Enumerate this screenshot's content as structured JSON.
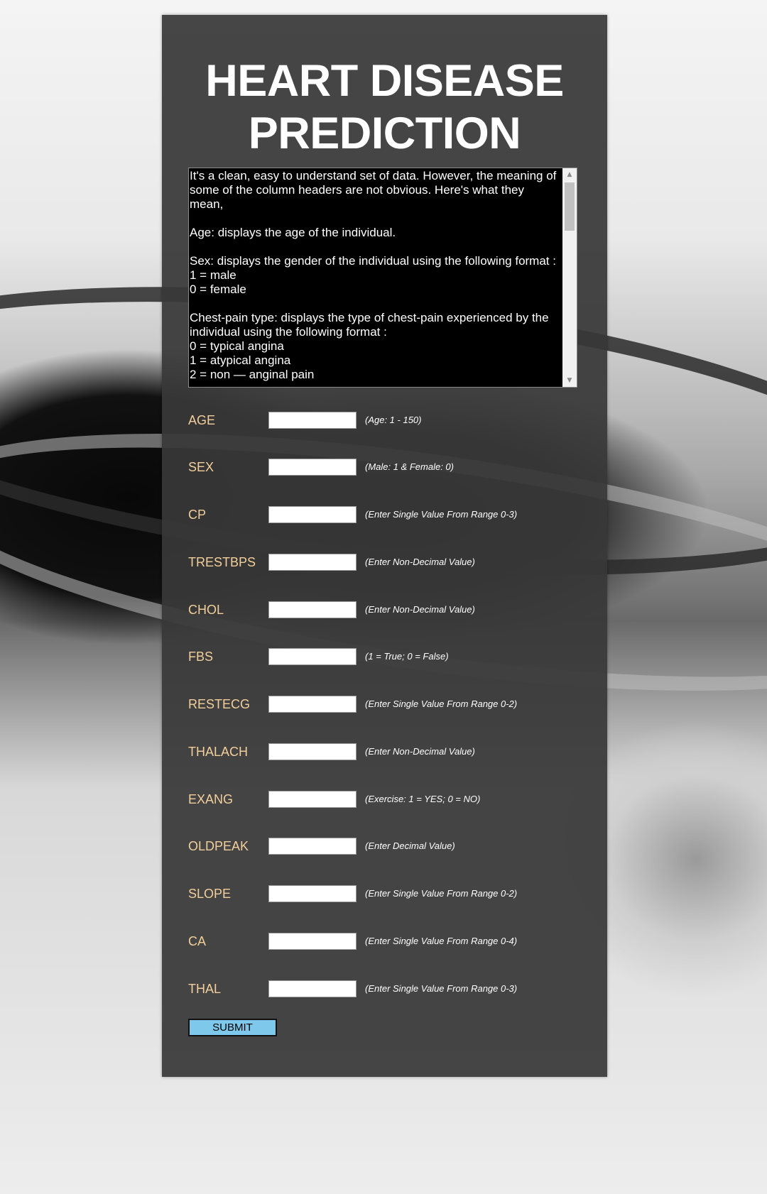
{
  "page": {
    "title": "HEART DISEASE PREDICTION"
  },
  "description": {
    "text": "It's a clean, easy to understand set of data. However, the meaning of some of the column headers are not obvious. Here's what they mean,\n\nAge: displays the age of the individual.\n\nSex: displays the gender of the individual using the following format :\n1 = male\n0 = female\n\nChest-pain type: displays the type of chest-pain experienced by the individual using the following format :\n0 = typical angina\n1 = atypical angina\n2 = non — anginal pain"
  },
  "form": {
    "fields": [
      {
        "label": "AGE",
        "value": "",
        "hint": "(Age: 1 - 150)"
      },
      {
        "label": "SEX",
        "value": "",
        "hint": "(Male: 1 & Female: 0)"
      },
      {
        "label": "CP",
        "value": "",
        "hint": "(Enter Single Value From Range 0-3)"
      },
      {
        "label": "TRESTBPS",
        "value": "",
        "hint": "(Enter Non-Decimal Value)"
      },
      {
        "label": "CHOL",
        "value": "",
        "hint": "(Enter Non-Decimal Value)"
      },
      {
        "label": "FBS",
        "value": "",
        "hint": "(1 = True; 0 = False)"
      },
      {
        "label": "RESTECG",
        "value": "",
        "hint": "(Enter Single Value From Range 0-2)"
      },
      {
        "label": "THALACH",
        "value": "",
        "hint": "(Enter Non-Decimal Value)"
      },
      {
        "label": "EXANG",
        "value": "",
        "hint": "(Exercise: 1 = YES; 0 = NO)"
      },
      {
        "label": "OLDPEAK",
        "value": "",
        "hint": "(Enter Decimal Value)"
      },
      {
        "label": "SLOPE",
        "value": "",
        "hint": "(Enter Single Value From Range 0-2)"
      },
      {
        "label": "CA",
        "value": "",
        "hint": "(Enter Single Value From Range 0-4)"
      },
      {
        "label": "THAL",
        "value": "",
        "hint": "(Enter Single Value From Range 0-3)"
      }
    ],
    "submit_label": "SUBMIT"
  },
  "colors": {
    "card_background": "#383838",
    "label_color": "#f2cf9a",
    "submit_background": "#7ec8ec"
  },
  "icons": {
    "scroll_up": "triangle-up-icon",
    "scroll_down": "triangle-down-icon"
  }
}
